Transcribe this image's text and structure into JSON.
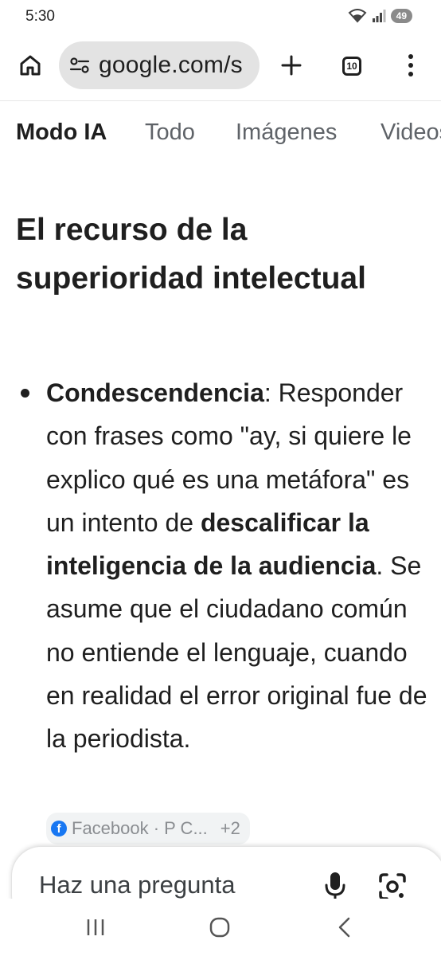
{
  "status_bar": {
    "time": "5:30",
    "battery": "49",
    "icons": [
      "wifi-icon",
      "signal-icon",
      "battery-icon"
    ]
  },
  "toolbar": {
    "url": "google.com/s",
    "tab_count": "10",
    "icons": [
      "home-icon",
      "site-settings-icon",
      "plus-icon",
      "tabs-icon",
      "more-vert-icon"
    ]
  },
  "search_tabs": [
    "Modo IA",
    "Todo",
    "Imágenes",
    "Videos"
  ],
  "content": {
    "heading": "El recurso de la superioridad intelectual",
    "bullet": {
      "term": "Condescendencia",
      "text1": ": Responder con frases como \"ay, si quiere le explico qué es una metáfora\" es un intento de ",
      "bold2": "descalificar la inteligencia de la audiencia",
      "text2": ". Se asume que el ciudadano común no entiende el lenguaje, cuando en realidad el error original fue de la periodista."
    },
    "source_chip": {
      "label": "Facebook · P C...",
      "more": "+2"
    }
  },
  "ask_bar": {
    "placeholder": "Haz una pregunta"
  },
  "colors": {
    "url_bar": "#e3e3e3",
    "text": "#1f1f1f",
    "muted_tab": "#5f6368",
    "facebook": "#1877f2"
  }
}
